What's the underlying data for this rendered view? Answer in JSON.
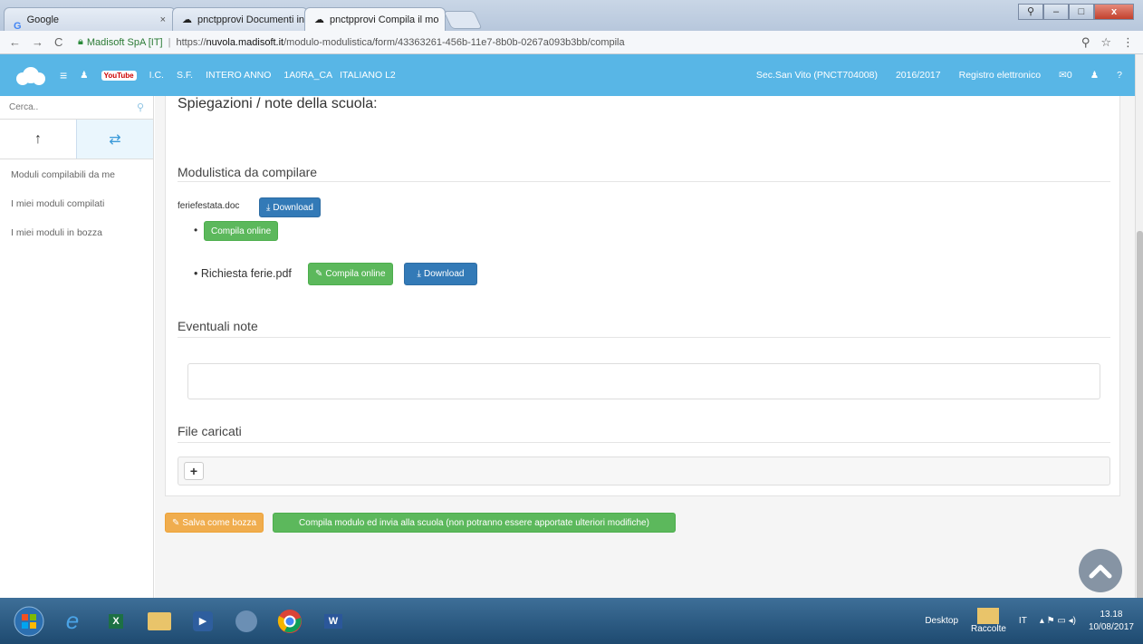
{
  "browser": {
    "tabs": [
      {
        "label": "Google"
      },
      {
        "label": "pnctpprovi Documenti in"
      },
      {
        "label": "pnctpprovi Compila il mo"
      }
    ],
    "nav": {
      "back": "←",
      "forward": "→",
      "reload": "C"
    },
    "secure_label": "Madisoft SpA [IT]",
    "url_prefix": "https://",
    "url_host": "nuvola.madisoft.it",
    "url_path": "/modulo-modulistica/form/43363261-456b-11e7-8b0b-0267a093b3bb/compila"
  },
  "topnav": {
    "youtube": "YouTube",
    "items": [
      "I.C.",
      "S.F.",
      "INTERO ANNO",
      "1A0RA_CA",
      "ITALIANO L2"
    ],
    "school": "Sec.San Vito (PNCT704008)",
    "year": "2016/2017",
    "registro": "Registro elettronico",
    "mail_count": "0"
  },
  "sidebar": {
    "search_placeholder": "Cerca..",
    "menu": [
      "Moduli compilabili da me",
      "I miei moduli compilati",
      "I miei moduli in bozza"
    ]
  },
  "main": {
    "spiegazioni_title": "Spiegazioni / note della scuola:",
    "modulistica_title": "Modulistica da compilare",
    "file1_name": "feriefestata.doc",
    "download_label": "Download",
    "compila_online_label": "Compila online",
    "file2_name": "Richiesta ferie.pdf",
    "note_title": "Eventuali note",
    "file_caricati_title": "File caricati",
    "salva_label": "Salva come bozza",
    "invia_label": "Compila modulo ed invia alla scuola (non potranno essere apportate ulteriori modifiche)"
  },
  "taskbar": {
    "desktop_label": "Desktop",
    "raccolte_label": "Raccolte",
    "lang": "IT",
    "time": "13.18",
    "date": "10/08/2017"
  },
  "colors": {
    "topnav": "#58b6e6",
    "green": "#5cb85c",
    "blue": "#337ab7",
    "orange": "#f0ad4e"
  }
}
